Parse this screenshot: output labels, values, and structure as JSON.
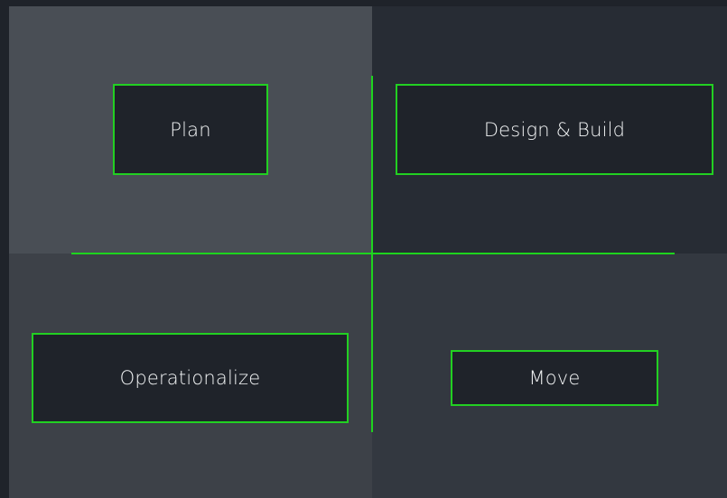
{
  "quadrants": [
    {
      "id": "top-left",
      "label": "Plan",
      "fill": "#494e55"
    },
    {
      "id": "top-right",
      "label": "Design & Build",
      "fill": "#272c34"
    },
    {
      "id": "bottom-left",
      "label": "Operationalize",
      "fill": "#3d4148"
    },
    {
      "id": "bottom-right",
      "label": "Move",
      "fill": "#333840"
    }
  ],
  "colors": {
    "accent": "#22d022",
    "box_fill": "#1f232a",
    "text": "#f2f4f5"
  }
}
